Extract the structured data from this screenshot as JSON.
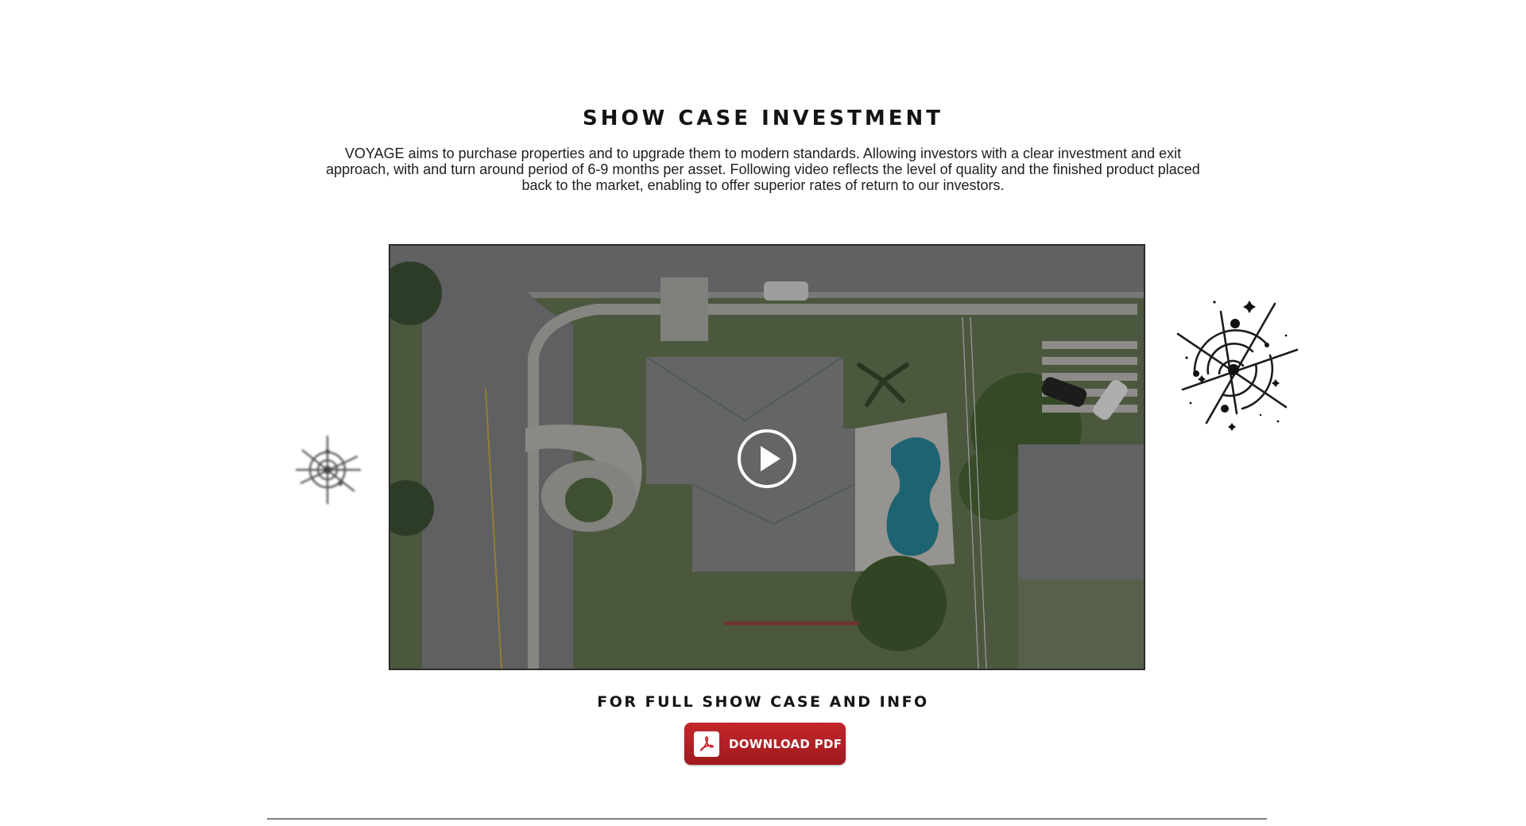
{
  "section": {
    "title": "SHOW CASE INVESTMENT",
    "description": "VOYAGE aims to purchase properties and to upgrade them to modern standards. Allowing investors with a clear investment and exit approach, with and turn around period of 6-9 months per asset. Following video reflects the level of quality and the finished product placed back to the market, enabling to offer superior rates of return to our investors."
  },
  "video": {
    "thumbnail": "aerial-view-of-house-with-pool",
    "play_icon": "play-icon"
  },
  "cta": {
    "subheading": "FOR FULL SHOW CASE AND INFO",
    "download_label": "DOWNLOAD PDF",
    "download_icon": "pdf-icon"
  },
  "decorations": {
    "left_icon": "compass-icon",
    "right_icon": "compass-icon"
  },
  "colors": {
    "button_red": "#b22025",
    "text_dark": "#141414",
    "divider": "#7f7f7f",
    "background": "#ffffff"
  }
}
